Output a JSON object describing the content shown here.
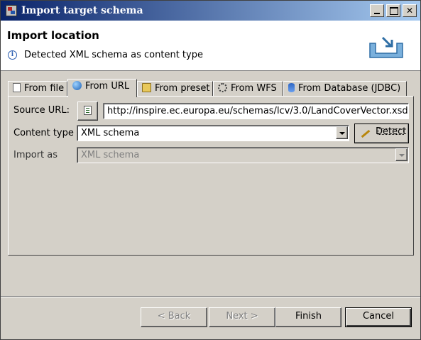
{
  "window": {
    "title": "Import target schema"
  },
  "banner": {
    "heading": "Import location",
    "message": "Detected XML schema as content type"
  },
  "tabs": [
    {
      "label": "From file",
      "icon": "file-icon"
    },
    {
      "label": "From URL",
      "icon": "globe-icon",
      "active": true
    },
    {
      "label": "From preset",
      "icon": "folder-icon"
    },
    {
      "label": "From WFS",
      "icon": "gears-icon"
    },
    {
      "label": "From Database (JDBC)",
      "icon": "database-icon"
    }
  ],
  "form": {
    "source_url_label": "Source URL:",
    "source_url_value": "http://inspire.ec.europa.eu/schemas/lcv/3.0/LandCoverVector.xsd",
    "content_type_label": "Content type",
    "content_type_value": "XML schema",
    "detect_label": "Detect",
    "import_as_label": "Import as",
    "import_as_value": "XML schema"
  },
  "buttons": {
    "back": "< Back",
    "next": "Next >",
    "finish": "Finish",
    "cancel": "Cancel"
  }
}
